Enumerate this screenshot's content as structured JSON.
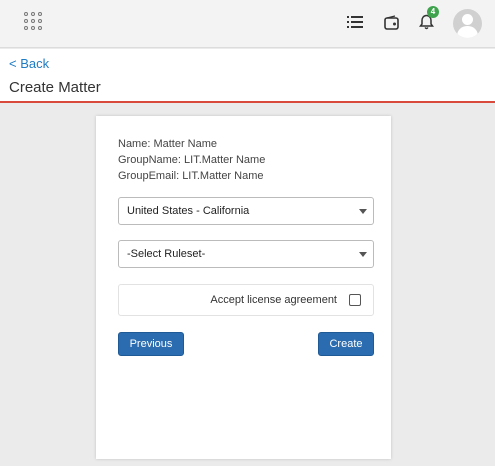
{
  "header": {
    "notification_count": "4",
    "icons": [
      "apps-grid-icon",
      "list-icon",
      "wallet-icon",
      "bell-icon",
      "user-avatar-icon"
    ]
  },
  "subheader": {
    "back_label": "< Back",
    "title": "Create Matter"
  },
  "form": {
    "info": {
      "name": "Name: Matter Name",
      "group_name": "GroupName: LIT.Matter Name",
      "group_email": "GroupEmail: LIT.Matter Name"
    },
    "jurisdiction_select": {
      "value": "United States - California"
    },
    "ruleset_select": {
      "value": "-Select Ruleset-"
    },
    "license": {
      "label": "Accept license agreement",
      "checked": false
    },
    "previous_label": "Previous",
    "create_label": "Create"
  },
  "colors": {
    "accent_line": "#d9493c",
    "link": "#1e7bc4",
    "primary_button": "#2b6cb0",
    "badge": "#3fa34d"
  }
}
